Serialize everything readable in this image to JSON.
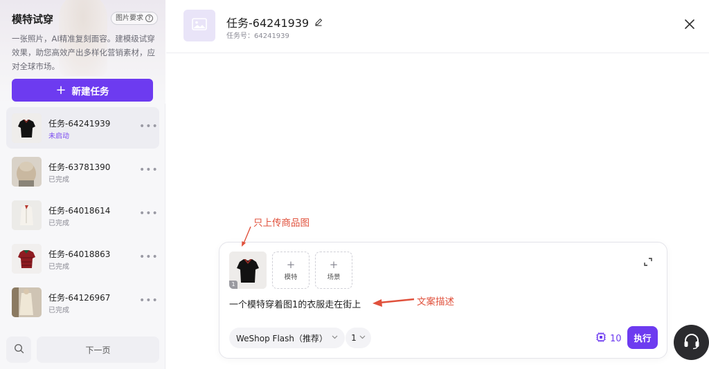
{
  "sidebar": {
    "title": "模特试穿",
    "requirements_chip": "图片要求",
    "help_symbol": "?",
    "description": "一张照片，AI精准复刻面容。建模级试穿效果，助您高效产出多样化营销素材，应对全球市场。",
    "new_task_label": "新建任务",
    "tasks": [
      {
        "name": "任务-64241939",
        "status": "未启动",
        "thumb": "black-polo"
      },
      {
        "name": "任务-63781390",
        "status": "已完成",
        "thumb": "beige-puffer"
      },
      {
        "name": "任务-64018614",
        "status": "已完成",
        "thumb": "white-cardigan"
      },
      {
        "name": "任务-64018863",
        "status": "已完成",
        "thumb": "red-polo"
      },
      {
        "name": "任务-64126967",
        "status": "已完成",
        "thumb": "cream-cardigan"
      }
    ],
    "next_page_label": "下一页"
  },
  "header": {
    "title": "任务-64241939",
    "subtitle": "任务号：64241939"
  },
  "composer": {
    "image_index": "1",
    "slots": [
      {
        "label": "模特"
      },
      {
        "label": "场景"
      }
    ],
    "prompt": "一个模特穿着图1的衣服走在街上",
    "model_select": "WeShop Flash（推荐）",
    "count_select": "1",
    "credits": "10",
    "run_label": "执行"
  },
  "annotations": {
    "upload_note": "只上传商品图",
    "prompt_note": "文案描述",
    "color": "#e0513c"
  },
  "colors": {
    "accent": "#6d3bf0",
    "status_pending": "#7a4af0"
  }
}
